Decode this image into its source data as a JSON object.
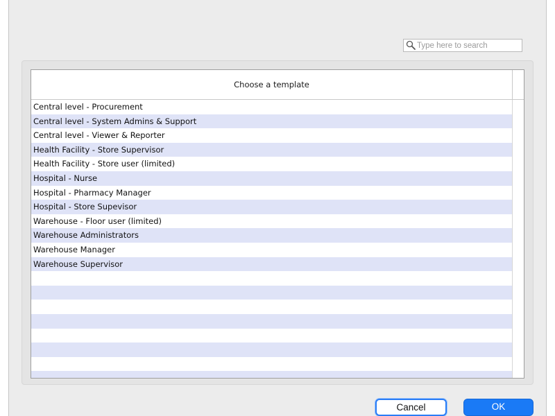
{
  "search": {
    "placeholder": "Type here to search",
    "value": ""
  },
  "table": {
    "column_header": "Choose a template",
    "rows": [
      "Central level - Procurement",
      "Central level - System Admins & Support",
      "Central level - Viewer & Reporter",
      "Health Facility - Store Supervisor",
      "Health Facility - Store user (limited)",
      "Hospital - Nurse",
      "Hospital - Pharmacy Manager",
      "Hospital - Store Supevisor",
      "Warehouse - Floor user (limited)",
      "Warehouse Administrators",
      "Warehouse Manager",
      "Warehouse Supervisor"
    ],
    "empty_rows": 8,
    "row_alt_color": "#dfe3f7"
  },
  "buttons": {
    "cancel_label": "Cancel",
    "ok_label": "OK",
    "accent_color": "#1a7af6"
  },
  "icons": {
    "search": "magnifier-icon"
  }
}
